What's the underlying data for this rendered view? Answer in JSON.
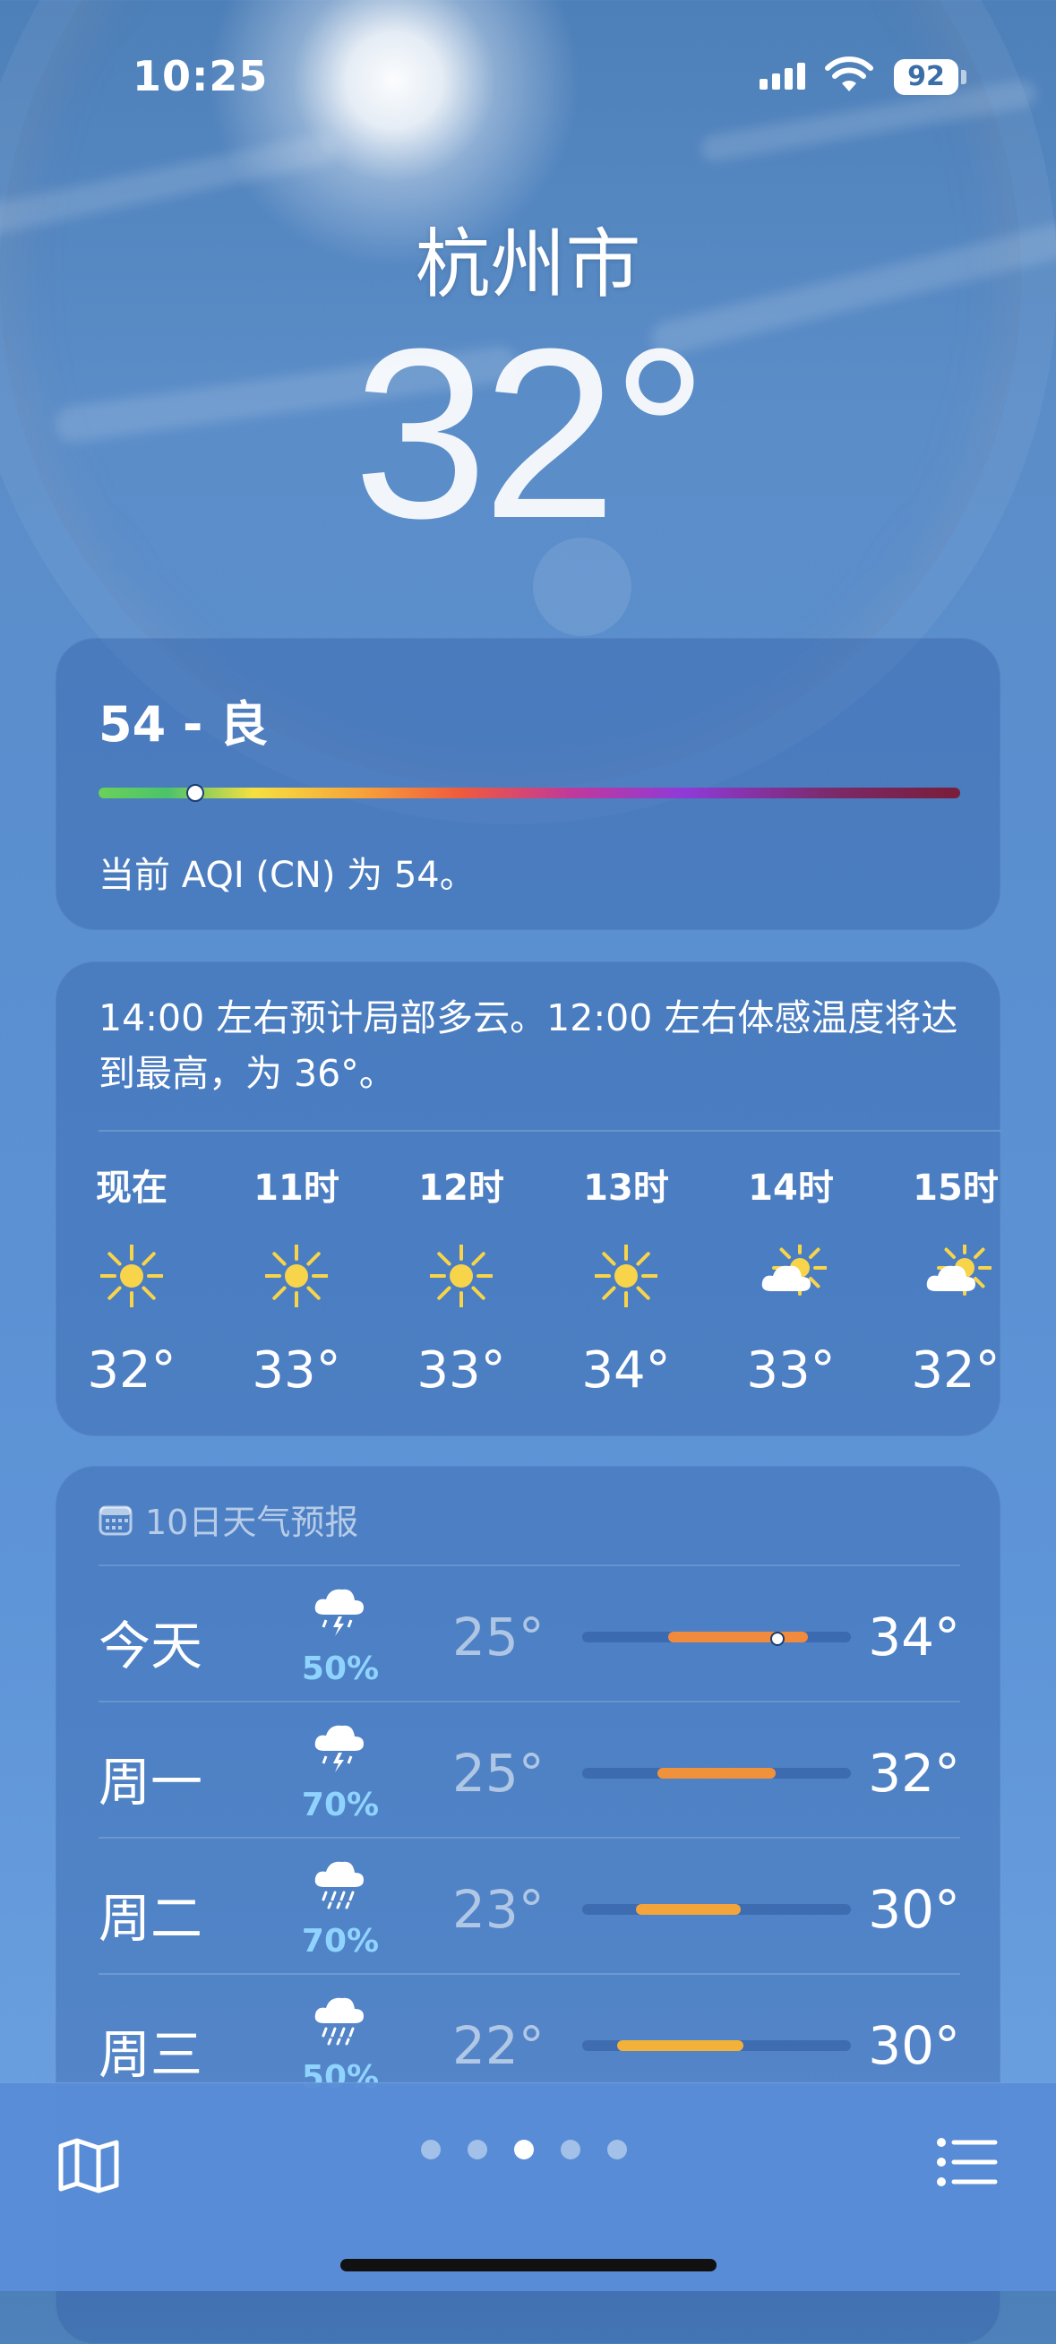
{
  "status_bar": {
    "time": "10:25",
    "battery": "92"
  },
  "location": {
    "city": "杭州市",
    "temperature": "32°"
  },
  "aqi": {
    "title": "54 - 良",
    "description": "当前 AQI (CN) 为 54。",
    "level_fraction": 0.11
  },
  "hourly": {
    "summary": "14:00 左右预计局部多云。12:00 左右体感温度将达到最高，为 36°。",
    "hours": [
      {
        "label": "现在",
        "icon": "sun-icon",
        "temp": "32°"
      },
      {
        "label": "11时",
        "icon": "sun-icon",
        "temp": "33°"
      },
      {
        "label": "12时",
        "icon": "sun-icon",
        "temp": "33°"
      },
      {
        "label": "13时",
        "icon": "sun-icon",
        "temp": "34°"
      },
      {
        "label": "14时",
        "icon": "partly-cloudy-icon",
        "temp": "33°"
      },
      {
        "label": "15时",
        "icon": "partly-cloudy-icon",
        "temp": "32°"
      }
    ]
  },
  "daily": {
    "header": "10日天气预报",
    "days": [
      {
        "name": "今天",
        "icon": "thunderstorm-icon",
        "precip": "50%",
        "low": "25°",
        "high": "34°",
        "fill_color": "#f08a3c",
        "fill_start": 0.32,
        "fill_end": 0.84,
        "current": 0.72
      },
      {
        "name": "周一",
        "icon": "thunderstorm-icon",
        "precip": "70%",
        "low": "25°",
        "high": "32°",
        "fill_color": "#f0923c",
        "fill_start": 0.28,
        "fill_end": 0.72
      },
      {
        "name": "周二",
        "icon": "rain-icon",
        "precip": "70%",
        "low": "23°",
        "high": "30°",
        "fill_color": "#f3a43a",
        "fill_start": 0.2,
        "fill_end": 0.59
      },
      {
        "name": "周三",
        "icon": "rain-icon",
        "precip": "50%",
        "low": "22°",
        "high": "30°",
        "fill_color": "#f2b23a",
        "fill_start": 0.13,
        "fill_end": 0.6
      }
    ]
  },
  "bottom_bar": {
    "page_count": 5,
    "active_page": 2
  }
}
